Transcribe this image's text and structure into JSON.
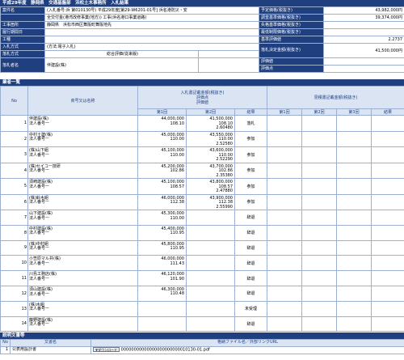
{
  "header": {
    "title": "平成29年度　静岡県　交通基盤部　浜松土木事務所　入札結果"
  },
  "info": {
    "case_name_label": "案件名",
    "case_name_1": "(入札番号:浜 第010130号) 平成29年度[第29-W6201-01号] 浜名港防災・安",
    "case_name_2": "全交付金(港湾改修事業(地方)) 工事(浜名港口事業道路)",
    "place_label": "工事箇所",
    "place_value": "静岡県　浜松市西区舞阪町舞阪地先",
    "period_label": "履行期間日",
    "kind_label": "工種",
    "method_label": "入札方式",
    "method_value": "(方法:電子入札)",
    "decision_label": "落札方式",
    "decision_value": "総合評価(従来版)",
    "winner_label": "落札者名",
    "winner_value": "伴建設(株)",
    "right_rows": [
      {
        "label": "予定価格(税抜き)",
        "value": "43,982,000円"
      },
      {
        "label": "調査基準価格(税抜き)",
        "value": "39,374,000円"
      },
      {
        "label": "失格基準価格(税抜き)",
        "value": ""
      },
      {
        "label": "最低制限価格(税抜き)",
        "value": ""
      },
      {
        "label": "基準評価値",
        "value": "2.2737"
      },
      {
        "label": "落札決定金額(税抜き)",
        "value": "41,500,000円"
      },
      {
        "label": "評価値",
        "value": ""
      },
      {
        "label": "評価点",
        "value": ""
      }
    ]
  },
  "bids": {
    "section_title": "業者一覧",
    "headers": {
      "no": "No",
      "name": "商号又は名称",
      "bid_group_1": "入札書記載金額(税抜き)",
      "bid_group_2": "評価点",
      "bid_group_3": "評価値",
      "redo_group": "見積書記載金額(税抜き)",
      "round1": "第1回",
      "round2": "第2回",
      "result": "結果",
      "round3": "第3回"
    },
    "rows": [
      {
        "no": "1",
        "name": "伴建設(株)",
        "rep": "法人番号ー",
        "r1a": "44,000,000",
        "r1b": "108.10",
        "r1c": "",
        "r2a": "41,500,000",
        "r2b": "108.10",
        "r2c": "2.60480",
        "result": "落札"
      },
      {
        "no": "2",
        "name": "中村土建(株)",
        "rep": "法人番号ー",
        "r1a": "45,000,000",
        "r1b": "110.00",
        "r1c": "",
        "r2a": "43,550,000",
        "r2b": "110.00",
        "r2c": "2.52580",
        "result": "参加"
      },
      {
        "no": "3",
        "name": "(株)山下組",
        "rep": "法人番号ー",
        "r1a": "45,100,000",
        "r1b": "110.00",
        "r1c": "",
        "r2a": "43,600,000",
        "r2b": "110.00",
        "r2c": "2.52290",
        "result": "参加"
      },
      {
        "no": "4",
        "name": "(株)セイコー技研",
        "rep": "法人番号ー",
        "r1a": "45,200,000",
        "r1b": "102.86",
        "r1c": "",
        "r2a": "43,700,000",
        "r2b": "102.86",
        "r2c": "2.35380",
        "result": "参加"
      },
      {
        "no": "5",
        "name": "須崎建設(株)",
        "rep": "法人番号ー",
        "r1a": "45,100,000",
        "r1b": "108.57",
        "r1c": "",
        "r2a": "43,800,000",
        "r2b": "108.57",
        "r2c": "2.47880",
        "result": "参加"
      },
      {
        "no": "6",
        "name": "(株)鈴木組",
        "rep": "法人番号ー",
        "r1a": "46,000,000",
        "r1b": "112.38",
        "r1c": "",
        "r2a": "43,900,000",
        "r2b": "112.38",
        "r2c": "2.55990",
        "result": "参加"
      },
      {
        "no": "7",
        "name": "山下建設(株)",
        "rep": "法人番号ー",
        "r1a": "45,300,000",
        "r1b": "110.00",
        "r1c": "",
        "r2a": "",
        "r2b": "",
        "r2c": "",
        "result": "辞退"
      },
      {
        "no": "8",
        "name": "中村建設(株)",
        "rep": "法人番号ー",
        "r1a": "45,400,000",
        "r1b": "110.95",
        "r1c": "",
        "r2a": "",
        "r2b": "",
        "r2c": "",
        "result": "辞退"
      },
      {
        "no": "9",
        "name": "(株)中村組",
        "rep": "法人番号ー",
        "r1a": "45,800,000",
        "r1b": "110.95",
        "r1c": "",
        "r2a": "",
        "r2b": "",
        "r2c": "",
        "result": "辞退"
      },
      {
        "no": "10",
        "name": "小笠原マル井(株)",
        "rep": "法人番号ー",
        "r1a": "46,000,000",
        "r1b": "111.43",
        "r1c": "",
        "r2a": "",
        "r2b": "",
        "r2c": "",
        "result": "辞退"
      },
      {
        "no": "11",
        "name": "川島工務店(株)",
        "rep": "法人番号ー",
        "r1a": "46,120,000",
        "r1b": "101.90",
        "r1c": "",
        "r2a": "",
        "r2b": "",
        "r2c": "",
        "result": "辞退"
      },
      {
        "no": "12",
        "name": "須山建設(株)",
        "rep": "法人番号ー",
        "r1a": "46,300,000",
        "r1b": "110.48",
        "r1c": "",
        "r2a": "",
        "r2b": "",
        "r2c": "",
        "result": "辞退"
      },
      {
        "no": "13",
        "name": "(株)水組",
        "rep": "法人番号ー",
        "r1a": "",
        "r1b": "",
        "r1c": "",
        "r2a": "",
        "r2b": "",
        "r2c": "",
        "result": "未受理"
      },
      {
        "no": "14",
        "name": "藤野建設(株)",
        "rep": "法人番号ー",
        "r1a": "",
        "r1b": "",
        "r1c": "",
        "r2a": "",
        "r2b": "",
        "r2c": "",
        "result": "辞退"
      }
    ]
  },
  "docs": {
    "section_title": "説明文書等",
    "headers": {
      "no": "No",
      "name": "文書名",
      "file": "格納ファイル名／外部リンクURL"
    },
    "rows": [
      {
        "no": "1",
        "name": "公表用設計書",
        "download": "ダウンロード",
        "file": "00000000000000000000000010130-01.pdf"
      }
    ]
  }
}
